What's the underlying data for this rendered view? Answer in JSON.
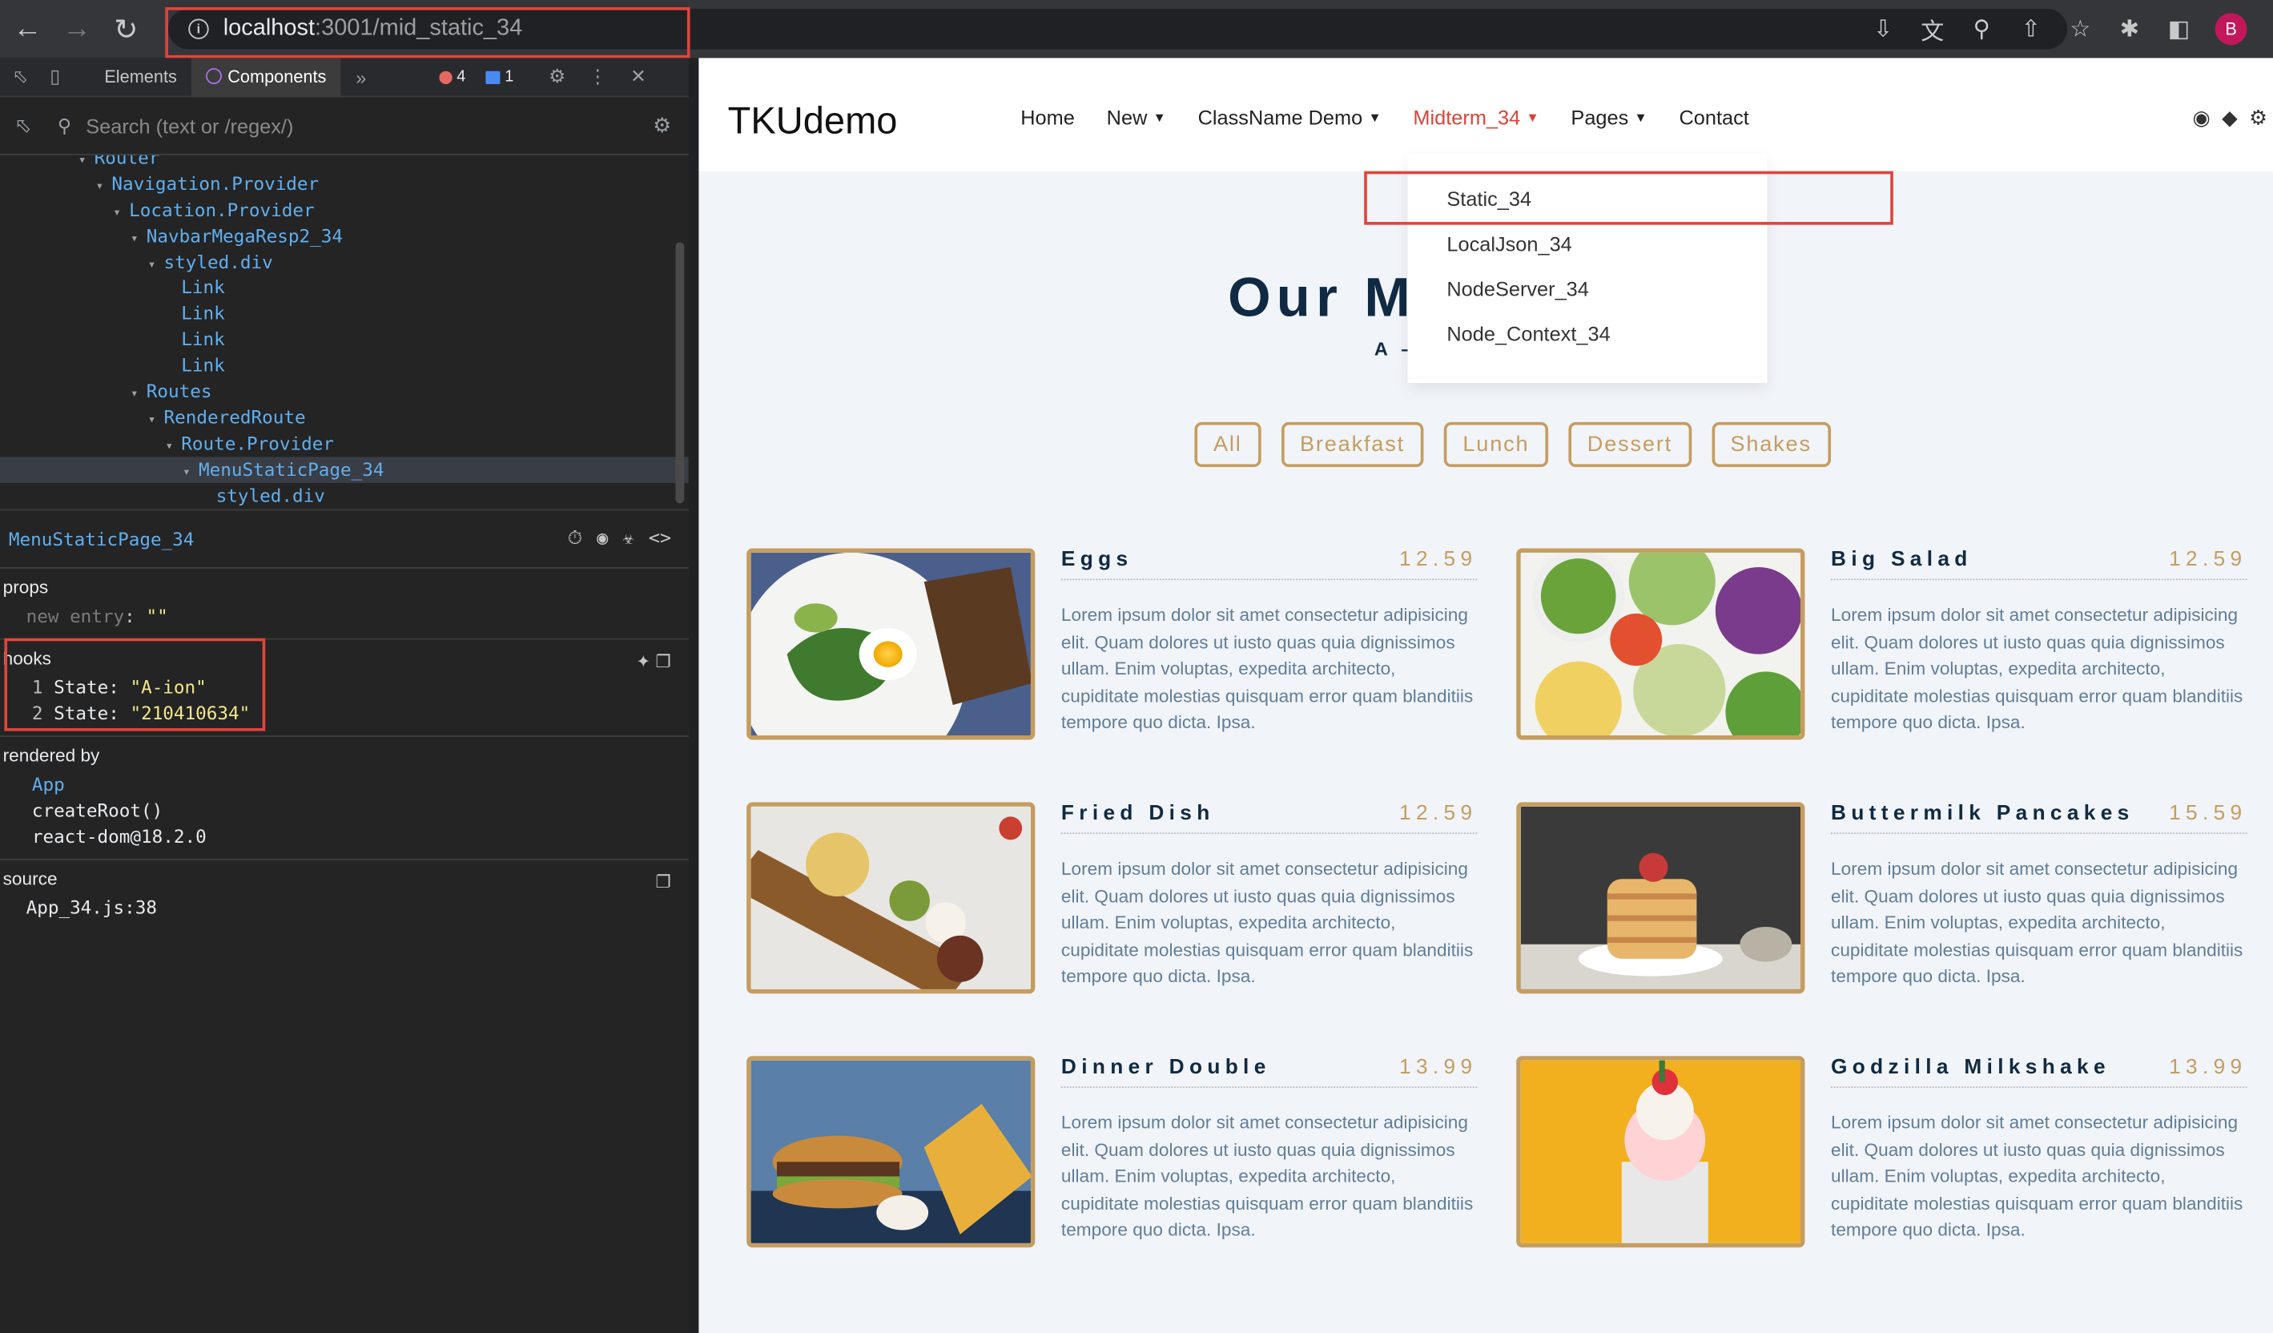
{
  "browser": {
    "url_host": "localhost",
    "url_path": ":3001/mid_static_34",
    "profile_initial": "B"
  },
  "devtools": {
    "tabs": [
      "Elements",
      "Components"
    ],
    "errors": "4",
    "messages": "1",
    "search_placeholder": "Search (text or /regex/)",
    "tree": [
      {
        "label": "Router",
        "depth": 0,
        "arrow": true
      },
      {
        "label": "Navigation.Provider",
        "depth": 1,
        "arrow": true
      },
      {
        "label": "Location.Provider",
        "depth": 2,
        "arrow": true
      },
      {
        "label": "NavbarMegaResp2_34",
        "depth": 3,
        "arrow": true
      },
      {
        "label": "styled.div",
        "depth": 4,
        "arrow": true
      },
      {
        "label": "Link",
        "depth": 5,
        "arrow": false
      },
      {
        "label": "Link",
        "depth": 5,
        "arrow": false
      },
      {
        "label": "Link",
        "depth": 5,
        "arrow": false
      },
      {
        "label": "Link",
        "depth": 5,
        "arrow": false
      },
      {
        "label": "Routes",
        "depth": 3,
        "arrow": true
      },
      {
        "label": "RenderedRoute",
        "depth": 4,
        "arrow": true
      },
      {
        "label": "Route.Provider",
        "depth": 5,
        "arrow": true
      },
      {
        "label": "MenuStaticPage_34",
        "depth": 6,
        "arrow": true,
        "selected": true
      },
      {
        "label": "styled.div",
        "depth": 7,
        "arrow": false
      }
    ],
    "selected_component": "MenuStaticPage_34",
    "props_title": "props",
    "props_key": "new entry",
    "props_value": "\"\"",
    "hooks_title": "hooks",
    "hooks": [
      {
        "index": "1",
        "label": "State:",
        "value": "\"A-ion\""
      },
      {
        "index": "2",
        "label": "State:",
        "value": "\"210410634\""
      }
    ],
    "rendered_by_title": "rendered by",
    "rendered_by": [
      "App",
      "createRoot()",
      "react-dom@18.2.0"
    ],
    "source_title": "source",
    "source": "App_34.js:38"
  },
  "site": {
    "brand": "TKUdemo",
    "nav": [
      {
        "label": "Home",
        "dropdown": false,
        "active": false
      },
      {
        "label": "New",
        "dropdown": true,
        "active": false
      },
      {
        "label": "ClassName Demo",
        "dropdown": true,
        "active": false
      },
      {
        "label": "Midterm_34",
        "dropdown": true,
        "active": true
      },
      {
        "label": "Pages",
        "dropdown": true,
        "active": false
      },
      {
        "label": "Contact",
        "dropdown": false,
        "active": false
      }
    ],
    "dropdown_items": [
      "Static_34",
      "LocalJson_34",
      "NodeServer_34",
      "Node_Context_34"
    ],
    "title": "Our M",
    "subtitle": "A –",
    "filters": [
      "All",
      "Breakfast",
      "Lunch",
      "Dessert",
      "Shakes"
    ],
    "menu_items": [
      {
        "name": "Eggs",
        "price": "12.59",
        "image": "eggs-plate",
        "desc": "Lorem ipsum dolor sit amet consectetur adipisicing elit. Quam dolores ut iusto quas quia dignissimos ullam. Enim voluptas, expedita architecto, cupiditate molestias quisquam error quam blanditiis tempore quo dicta. Ipsa."
      },
      {
        "name": "Big Salad",
        "price": "12.59",
        "image": "salad-bowls",
        "desc": "Lorem ipsum dolor sit amet consectetur adipisicing elit. Quam dolores ut iusto quas quia dignissimos ullam. Enim voluptas, expedita architecto, cupiditate molestias quisquam error quam blanditiis tempore quo dicta. Ipsa."
      },
      {
        "name": "Fried Dish",
        "price": "12.59",
        "image": "fried-board",
        "desc": "Lorem ipsum dolor sit amet consectetur adipisicing elit. Quam dolores ut iusto quas quia dignissimos ullam. Enim voluptas, expedita architecto, cupiditate molestias quisquam error quam blanditiis tempore quo dicta. Ipsa."
      },
      {
        "name": "Buttermilk Pancakes",
        "price": "15.59",
        "image": "pancake-stack",
        "desc": "Lorem ipsum dolor sit amet consectetur adipisicing elit. Quam dolores ut iusto quas quia dignissimos ullam. Enim voluptas, expedita architecto, cupiditate molestias quisquam error quam blanditiis tempore quo dicta. Ipsa."
      },
      {
        "name": "Dinner Double",
        "price": "13.99",
        "image": "burger-fries",
        "desc": "Lorem ipsum dolor sit amet consectetur adipisicing elit. Quam dolores ut iusto quas quia dignissimos ullam. Enim voluptas, expedita architecto, cupiditate molestias quisquam error quam blanditiis tempore quo dicta. Ipsa."
      },
      {
        "name": "Godzilla Milkshake",
        "price": "13.99",
        "image": "milkshake",
        "desc": "Lorem ipsum dolor sit amet consectetur adipisicing elit. Quam dolores ut iusto quas quia dignissimos ullam. Enim voluptas, expedita architecto, cupiditate molestias quisquam error quam blanditiis tempore quo dicta. Ipsa."
      }
    ]
  },
  "colors": {
    "accent": "#c59d5f",
    "active_nav": "#d8453a",
    "highlight_box": "#e0453a"
  }
}
